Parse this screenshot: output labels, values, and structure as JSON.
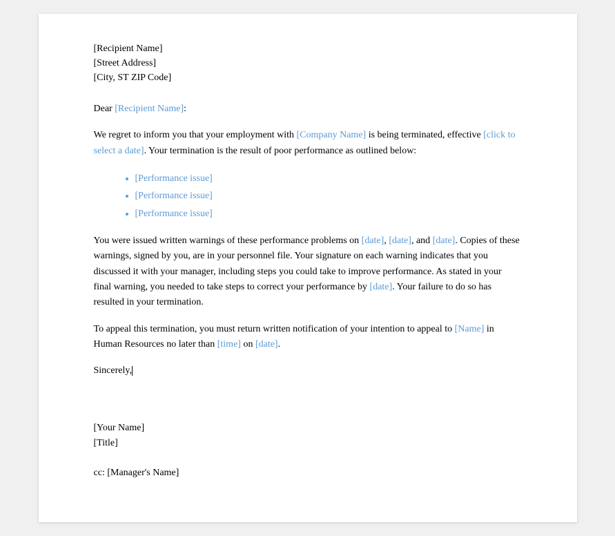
{
  "document": {
    "address": {
      "recipient": "[Recipient Name]",
      "street": "[Street Address]",
      "city": "[City, ST ZIP Code]"
    },
    "salutation": {
      "text": "Dear ",
      "recipient_placeholder": "[Recipient Name]",
      "colon": ":"
    },
    "paragraph1": {
      "before_company": "We regret to inform you that your employment with ",
      "company_placeholder": "[Company Name]",
      "after_company": " is being terminated, effective ",
      "date_placeholder": "[click to select a date]",
      "after_date": ". Your termination is the result of poor performance as outlined below:"
    },
    "bullet_items": [
      "[Performance issue]",
      "[Performance issue]",
      "[Performance issue]"
    ],
    "paragraph2": {
      "before": "You were issued written warnings of these performance problems on ",
      "date1": "[date]",
      "comma1": ", ",
      "date2": "[date]",
      "and": ", and ",
      "date3": "[date]",
      "after1": ". Copies of these warnings, signed by you, are in your personnel file. Your signature on each warning indicates  that you discussed it with your manager, including  steps you could take to improve performance. As stated in your final warning, you needed to take steps to correct your performance by ",
      "date4": "[date]",
      "after2": ". Your failure to do so has resulted in your termination."
    },
    "paragraph3": {
      "before": "To appeal this termination, you must  return written notification of your intention to appeal to ",
      "name_placeholder": "[Name]",
      "middle": " in Human Resources no later than ",
      "time_placeholder": "[time]",
      "on": " on ",
      "date_placeholder": "[date]",
      "period": "."
    },
    "sincerely": "Sincerely,",
    "signature": {
      "name": "[Your Name]",
      "title": "[Title]"
    },
    "cc": {
      "label": "cc: ",
      "name": "[Manager's Name]"
    }
  }
}
